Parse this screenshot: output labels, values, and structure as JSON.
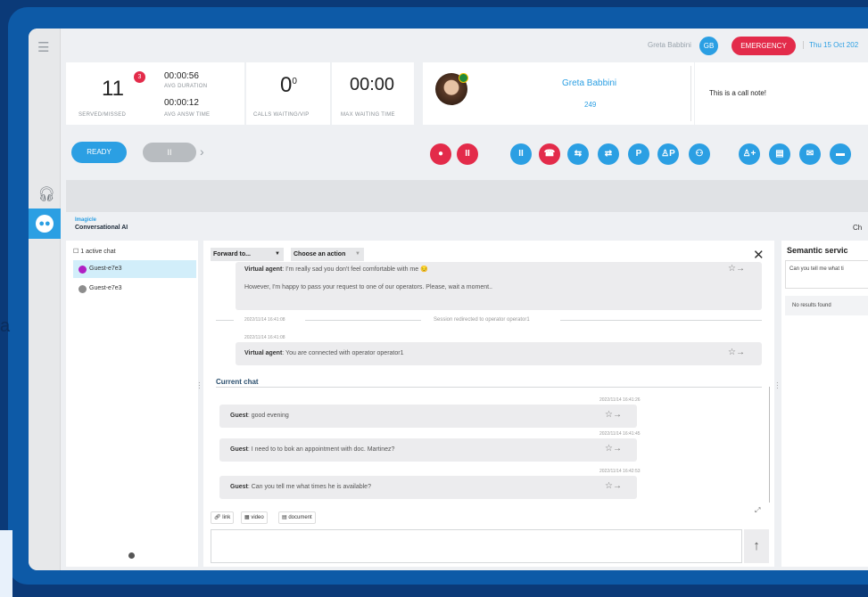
{
  "background_letter": "a",
  "topbar": {
    "user_name": "Greta Babbini",
    "user_initials": "GB",
    "emergency_label": "EMERGENCY",
    "date": "Thu 15 Oct 202"
  },
  "stats": {
    "served": "11",
    "missed_badge": "3",
    "served_label": "SERVED/MISSED",
    "avg_duration": "00:00:56",
    "avg_duration_label": "AVG DURATION",
    "avg_answer": "00:00:12",
    "avg_answer_label": "AVG ANSW TIME",
    "calls_waiting": "0",
    "calls_vip": "0",
    "calls_waiting_label": "CALLS WAITING/VIP",
    "max_waiting": "00:00",
    "max_waiting_label": "MAX WAITING TIME"
  },
  "contact": {
    "name": "Greta Babbini",
    "extension": "249",
    "note": "This is a call note!"
  },
  "controls": {
    "ready_label": "READY",
    "pause_label": "II",
    "chevron": "›",
    "buttons": [
      {
        "icon": "record-icon",
        "glyph": "●",
        "color": "#e32b4a"
      },
      {
        "icon": "pause-record-icon",
        "glyph": "II",
        "color": "#e32b4a"
      },
      {
        "icon": "hold-icon",
        "glyph": "II",
        "color": "#2b9fe3"
      },
      {
        "icon": "hangup-icon",
        "glyph": "☎",
        "color": "#e32b4a"
      },
      {
        "icon": "transfer-icon",
        "glyph": "⇆",
        "color": "#2b9fe3"
      },
      {
        "icon": "consult-icon",
        "glyph": "⇄",
        "color": "#2b9fe3"
      },
      {
        "icon": "park-icon",
        "glyph": "P",
        "color": "#2b9fe3"
      },
      {
        "icon": "user-park-icon",
        "glyph": "♙P",
        "color": "#2b9fe3"
      },
      {
        "icon": "conference-icon",
        "glyph": "⚇",
        "color": "#2b9fe3"
      },
      {
        "icon": "add-user-icon",
        "glyph": "♙+",
        "color": "#2b9fe3"
      },
      {
        "icon": "document-icon",
        "glyph": "▤",
        "color": "#2b9fe3"
      },
      {
        "icon": "mail-icon",
        "glyph": "✉",
        "color": "#2b9fe3"
      },
      {
        "icon": "chat-icon",
        "glyph": "▬",
        "color": "#2b9fe3"
      }
    ]
  },
  "app": {
    "brand": "Imagicle",
    "name": "Conversational AI",
    "right_fragment": "Ch"
  },
  "chat_list": {
    "active_count": "1 active chat",
    "guests": [
      {
        "name": "Guest-e7e3",
        "color": "#b01fc4"
      },
      {
        "name": "Guest-e7e3",
        "color": "#8d8d8d"
      }
    ]
  },
  "conversation": {
    "forward_label": "Forward to...",
    "forward_arrow": "▼",
    "action_label": "Choose an action",
    "action_arrow": "▼",
    "close_label": "✕",
    "partial_sender": "Virtual agent",
    "partial_text": ": I'm really sad you don't feel comfortable with me 😔",
    "history_msg": "However, I'm happy to pass your request to one of our operators. Please, wait a moment..",
    "redirect_ts": "2022/11/14 16:41:08",
    "redirect_text": "Session redirected to operator operator1",
    "connected_ts": "2022/11/14 16:41:08",
    "connected_sender": "Virtual agent",
    "connected_text": ": You are connected with operator operator1",
    "current_chat_label": "Current chat",
    "messages": [
      {
        "ts": "2022/11/14 16:41:26",
        "sender": "Guest",
        "text": ": good evening"
      },
      {
        "ts": "2022/11/14 16:41:45",
        "sender": "Guest",
        "text": ": I need to to bok an appointment with doc. Martinez?"
      },
      {
        "ts": "2022/11/14 16:42:53",
        "sender": "Guest",
        "text": ": Can you tell me what times he is available?"
      }
    ],
    "star_glyph": "☆→",
    "attachments": {
      "link": "link",
      "video": "video",
      "document": "document"
    },
    "send_glyph": "↑"
  },
  "semantic": {
    "title": "Semantic servic",
    "query": "Can you tell me what ti",
    "results": "No results found"
  }
}
